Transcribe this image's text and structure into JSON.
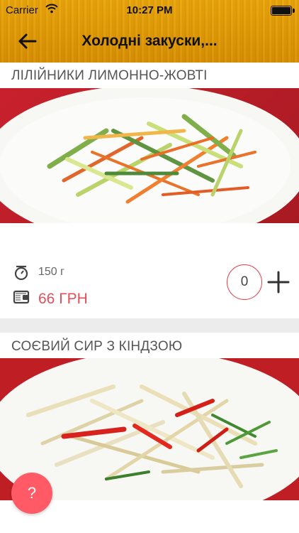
{
  "status_bar": {
    "carrier": "Carrier",
    "time": "10:27 PM"
  },
  "nav": {
    "title": "Холодні закуски,..."
  },
  "dishes": [
    {
      "name": "ЛІЛІЙНИКИ ЛИМОННО-ЖОВТІ",
      "weight": "150 г",
      "price": "66 ГРН",
      "quantity": "0"
    },
    {
      "name": "СОЄВИЙ СИР З КІНДЗОЮ"
    }
  ],
  "help_button": {
    "label": "?"
  },
  "colors": {
    "header": "#e09a06",
    "accent": "#e0505a",
    "help_button": "#ff5a66",
    "quantity_border": "#e23b45"
  },
  "icons": [
    "back-arrow-icon",
    "wifi-icon",
    "battery-icon",
    "scale-icon",
    "wallet-icon",
    "plus-icon"
  ]
}
